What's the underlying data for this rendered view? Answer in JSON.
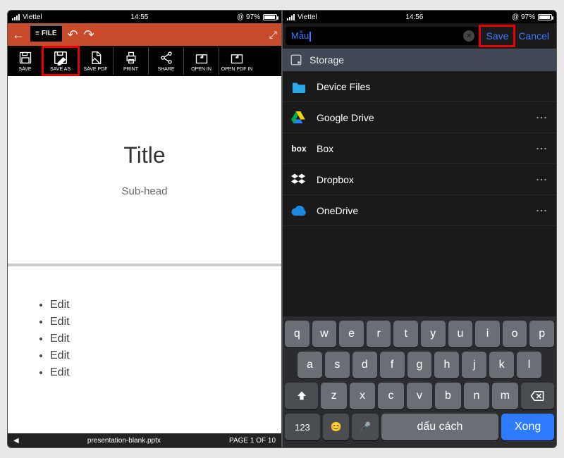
{
  "status": {
    "carrier": "Viettel",
    "time_left": "14:55",
    "time_right": "14:56",
    "battery": "97%"
  },
  "left": {
    "file_tab": "FILE",
    "tools": {
      "save": "SAVE",
      "save_as": "SAVE AS",
      "save_pdf": "SAVE PDF",
      "print": "PRINT",
      "share": "SHARE",
      "open_in": "OPEN IN",
      "open_pdf_in": "OPEN PDF IN"
    },
    "slide1": {
      "title": "Title",
      "sub": "Sub-head"
    },
    "slide2_items": [
      "Edit",
      "Edit",
      "Edit",
      "Edit",
      "Edit"
    ],
    "footer_filename": "presentation-blank.pptx",
    "footer_page": "PAGE 1 OF 10"
  },
  "right": {
    "filename_value": "Mẫu",
    "save_label": "Save",
    "cancel_label": "Cancel",
    "storage_header": "Storage",
    "sources": [
      {
        "key": "device",
        "label": "Device Files",
        "more": false
      },
      {
        "key": "gdrive",
        "label": "Google Drive",
        "more": true
      },
      {
        "key": "box",
        "label": "Box",
        "more": true
      },
      {
        "key": "dropbox",
        "label": "Dropbox",
        "more": true
      },
      {
        "key": "onedrive",
        "label": "OneDrive",
        "more": true
      }
    ],
    "keyboard": {
      "row1": [
        "q",
        "w",
        "e",
        "r",
        "t",
        "y",
        "u",
        "i",
        "o",
        "p"
      ],
      "row2": [
        "a",
        "s",
        "d",
        "f",
        "g",
        "h",
        "j",
        "k",
        "l"
      ],
      "row3_mid": [
        "z",
        "x",
        "c",
        "v",
        "b",
        "n",
        "m"
      ],
      "num_label": "123",
      "space_label": "dấu cách",
      "done_label": "Xong"
    }
  }
}
